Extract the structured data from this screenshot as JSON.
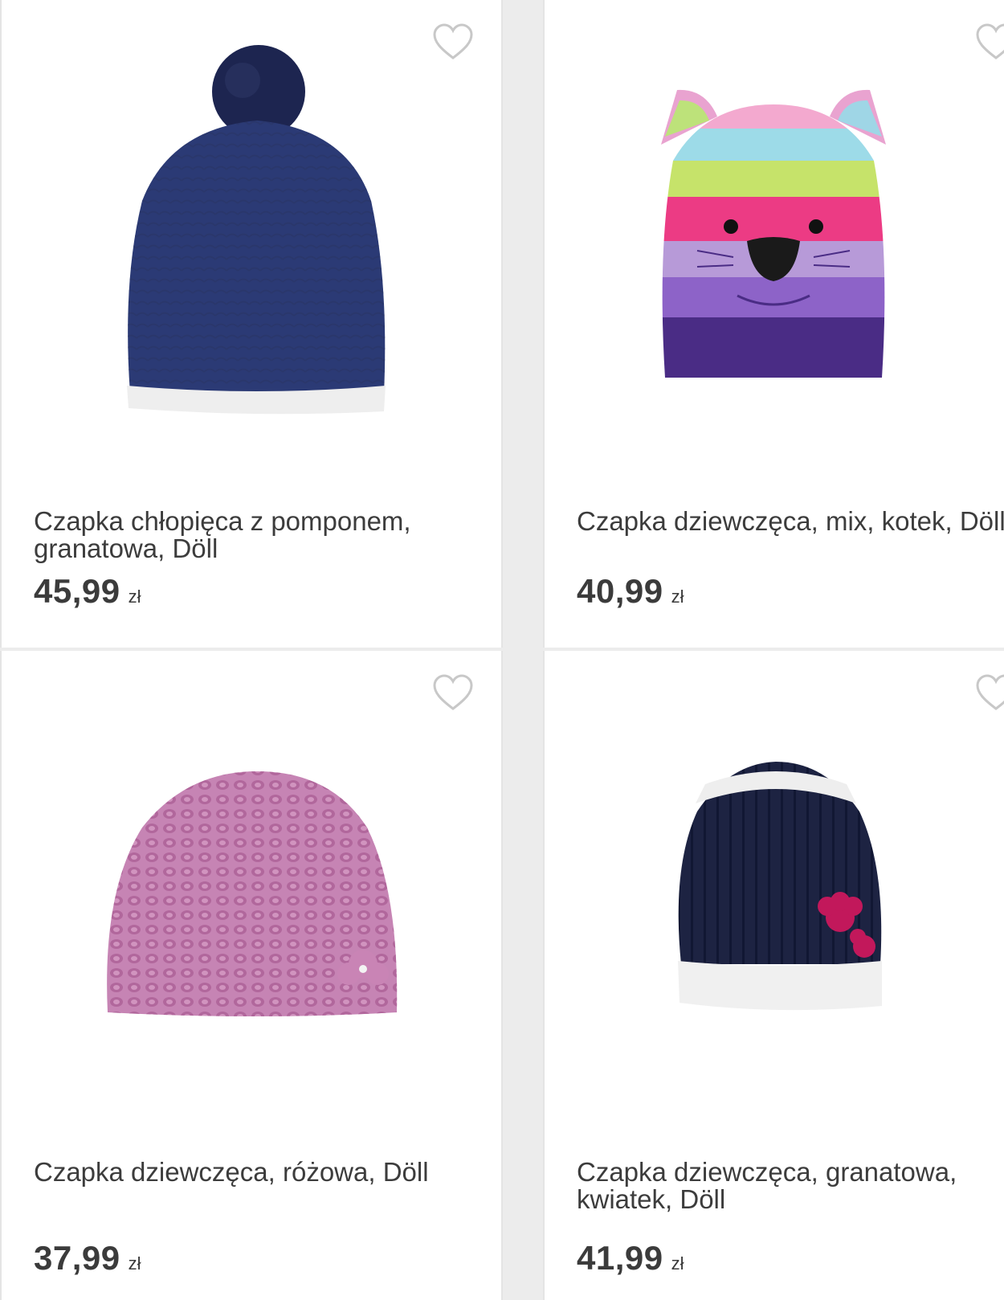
{
  "products": [
    {
      "title": "Czapka chłopięca z pomponem, granatowa, Döll",
      "price": "45,99",
      "currency": "zł",
      "image_icon": "navy-pompom-beanie"
    },
    {
      "title": "Czapka dziewczęca, mix, kotek, Döll",
      "price": "40,99",
      "currency": "zł",
      "image_icon": "striped-cat-beanie"
    },
    {
      "title": "Czapka dziewczęca, różowa, Döll",
      "price": "37,99",
      "currency": "zł",
      "image_icon": "pink-knit-beanie"
    },
    {
      "title": "Czapka dziewczęca, granatowa, kwiatek, Döll",
      "price": "41,99",
      "currency": "zł",
      "image_icon": "navy-flower-beanie"
    }
  ],
  "colors": {
    "text": "#3c3c3c",
    "heart": "#c8c8c8",
    "card_bg": "#ffffff",
    "gap": "#ececec"
  }
}
